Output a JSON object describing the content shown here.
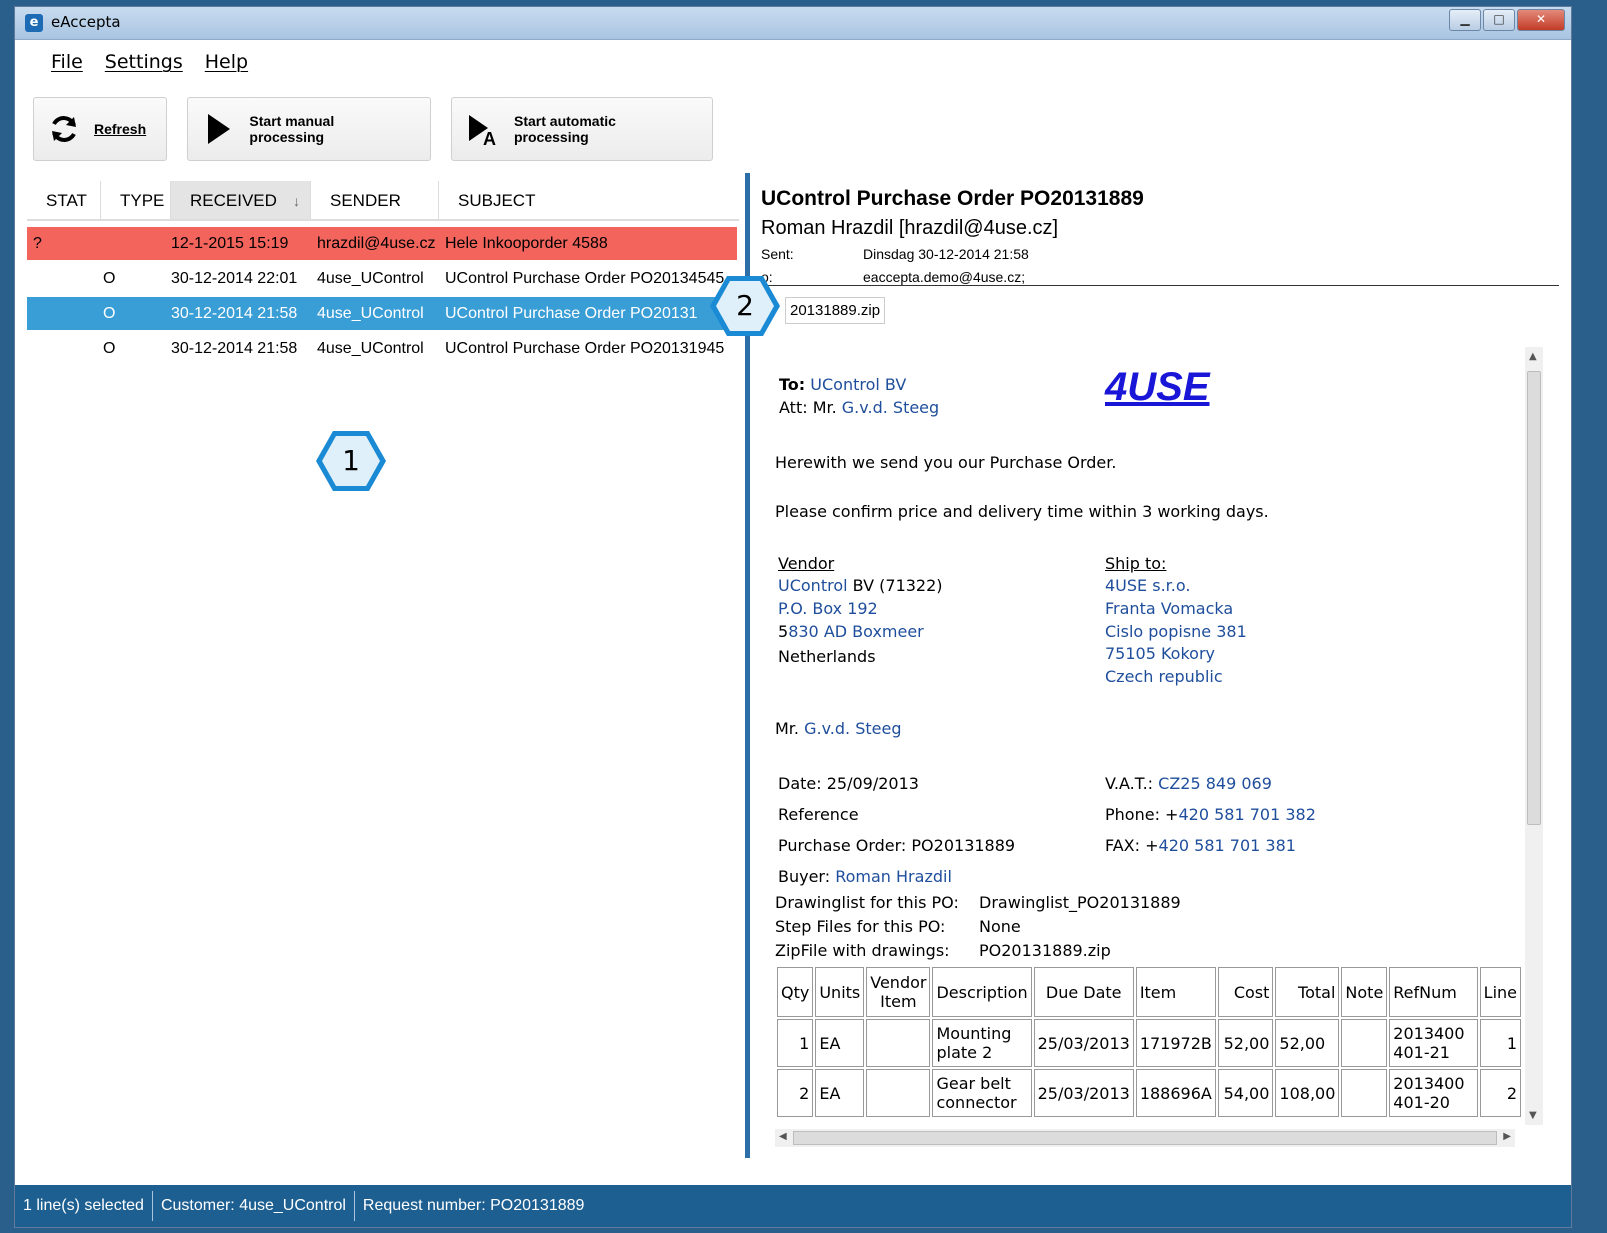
{
  "window": {
    "title": "eAccepta"
  },
  "menu": [
    "File",
    "Settings",
    "Help"
  ],
  "toolbar": {
    "refresh": "Refresh",
    "manual": "Start manual processing",
    "automatic": "Start automatic processing"
  },
  "list": {
    "columns": [
      "STAT",
      "TYPE",
      "RECEIVED",
      "SENDER",
      "SUBJECT"
    ],
    "rows": [
      {
        "stat": "?",
        "type": "",
        "received": "12-1-2015 15:19",
        "sender": "hrazdil@4use.cz",
        "subject": "Hele Inkooporder 4588"
      },
      {
        "stat": "",
        "type": "O",
        "received": "30-12-2014 22:01",
        "sender": "4use_UControl",
        "subject": "UControl Purchase Order PO20134545"
      },
      {
        "stat": "",
        "type": "O",
        "received": "30-12-2014 21:58",
        "sender": "4use_UControl",
        "subject": "UControl Purchase Order PO20131"
      },
      {
        "stat": "",
        "type": "O",
        "received": "30-12-2014 21:58",
        "sender": "4use_UControl",
        "subject": "UControl Purchase Order PO20131945"
      }
    ]
  },
  "badges": {
    "one": "1",
    "two": "2"
  },
  "preview": {
    "subject": "UControl Purchase Order PO20131889",
    "from": "Roman Hrazdil [hrazdil@4use.cz]",
    "sent_label": "Sent:",
    "sent_value": "Dinsdag 30-12-2014 21:58",
    "to_label": "o:",
    "to_value": "eaccepta.demo@4use.cz;",
    "attachment": "20131889.zip"
  },
  "mail": {
    "to_label": "To:",
    "to": "UControl BV",
    "att_label": "Att: Mr.",
    "att": "G.v.d. Steeg",
    "logo": "4USE",
    "line1": "Herewith we send you our Purchase Order.",
    "line2": "Please confirm price and delivery time within 3 working days.",
    "vendor_h": "Vendor",
    "vendor1a": "UControl",
    "vendor1b": " BV (71322)",
    "vendor2": "P.O. Box 192",
    "vendor3a": "5",
    "vendor3b": "830 AD Boxmeer",
    "vendor4": "Netherlands",
    "ship_h": "Ship to:",
    "ship1": "4USE s.r.o.",
    "ship2": "Franta Vomacka",
    "ship3": "Cislo popisne 381",
    "ship4": "75105 Kokory",
    "ship5": "Czech republic",
    "mr_label": "Mr.",
    "mr": "G.v.d. Steeg",
    "date": "Date: 25/09/2013",
    "vat_label": "V.A.T.:",
    "vat": "CZ25 849 069",
    "reference": "Reference",
    "phone_label": "Phone: +",
    "phone": "420 581 701 382",
    "po": "Purchase Order: PO20131889",
    "fax_label": "FAX: +",
    "fax": "420 581 701 381",
    "buyer_label": "Buyer:",
    "buyer": "Roman Hrazdil",
    "dl_label": "Drawinglist for this PO:",
    "dl": "Drawinglist_PO20131889",
    "step_label": "Step Files for this PO:",
    "step": "None",
    "zip_label": "ZipFile with drawings:",
    "zip": "PO20131889.zip",
    "table": {
      "headers": [
        "Qty",
        "Units",
        "Vendor Item",
        "Description",
        "Due Date",
        "Item",
        "Cost",
        "Total",
        "Note",
        "RefNum",
        "Line"
      ],
      "rows": [
        [
          "1",
          "EA",
          "",
          "Mounting plate 2",
          "25/03/2013",
          "171972B",
          "52,00",
          "52,00",
          "",
          "2013400401-21",
          "1"
        ],
        [
          "2",
          "EA",
          "",
          "Gear belt connector",
          "25/03/2013",
          "188696A",
          "54,00",
          "108,00",
          "",
          "2013400401-20",
          "2"
        ]
      ]
    }
  },
  "status": {
    "selected": "1 line(s) selected",
    "customer": "Customer: 4use_UControl",
    "request": "Request number: PO20131889"
  },
  "colors": {
    "error_row": "#f2645c",
    "selected_row": "#3a9ed6",
    "statusbar": "#1e5f92",
    "badge": "#1a8ad4"
  }
}
